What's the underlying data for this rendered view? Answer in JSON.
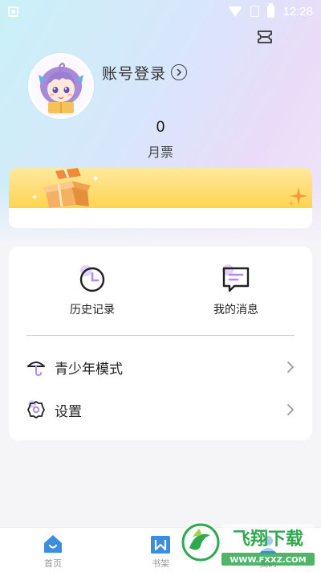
{
  "status_bar": {
    "time": "12:28"
  },
  "profile": {
    "login_label": "账号登录",
    "tickets_count": "0",
    "tickets_label": "月票"
  },
  "quick_actions": [
    {
      "label": "历史记录",
      "icon": "clock-icon"
    },
    {
      "label": "我的消息",
      "icon": "message-icon"
    }
  ],
  "menu": [
    {
      "label": "青少年模式",
      "icon": "umbrella-icon"
    },
    {
      "label": "设置",
      "icon": "gear-icon"
    }
  ],
  "bottom_nav": [
    {
      "label": "首页",
      "icon": "home-icon"
    },
    {
      "label": "书架",
      "icon": "bookshelf-icon"
    },
    {
      "label": "我的",
      "icon": "profile-icon"
    }
  ],
  "watermark": {
    "title": "飞翔下载",
    "url": "WWW.FXXZ.COM"
  },
  "colors": {
    "accent_purple": "#b48cf0",
    "banner_yellow": "#ffd44e",
    "nav_blue": "#3b8de0",
    "watermark_green": "#2fa84f"
  }
}
